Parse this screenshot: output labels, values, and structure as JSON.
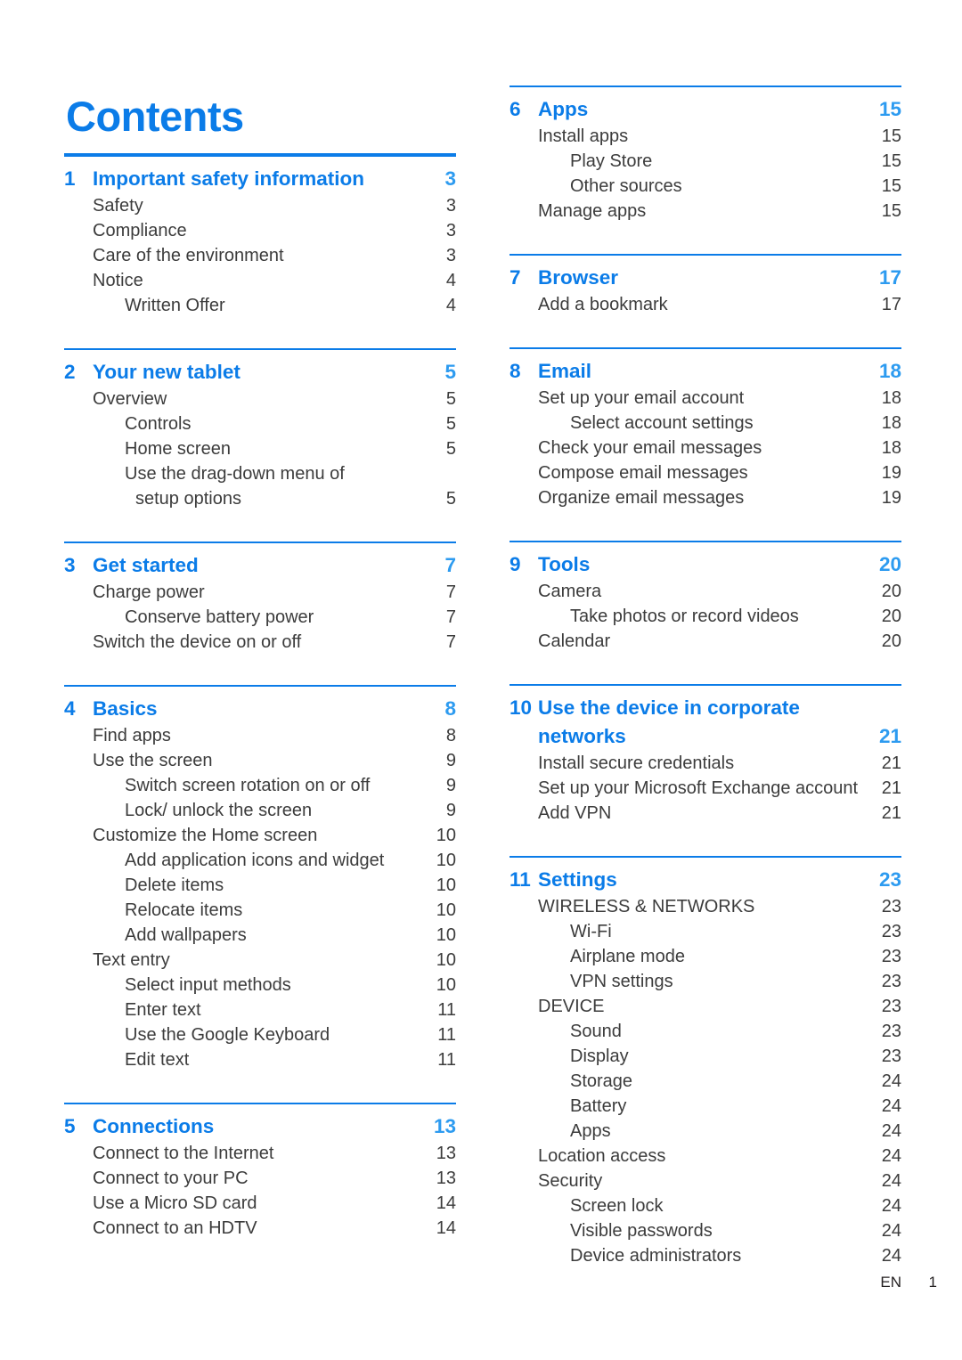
{
  "document": {
    "title": "Contents",
    "accent_color": "#0b7ce8",
    "text_color": "#3c3c3c"
  },
  "footer": {
    "language": "EN",
    "page_number": "1"
  },
  "columns": [
    {
      "name": "left",
      "chapters": [
        {
          "number": "1",
          "title": "Important safety information",
          "page": "3",
          "rule": "thick",
          "entries": [
            {
              "level": 1,
              "label": "Safety",
              "page": "3"
            },
            {
              "level": 1,
              "label": "Compliance",
              "page": "3"
            },
            {
              "level": 1,
              "label": "Care of the environment",
              "page": "3"
            },
            {
              "level": 1,
              "label": "Notice",
              "page": "4"
            },
            {
              "level": 2,
              "label": "Written Offer",
              "page": "4"
            }
          ]
        },
        {
          "number": "2",
          "title": "Your new tablet",
          "page": "5",
          "rule": "thin",
          "entries": [
            {
              "level": 1,
              "label": "Overview",
              "page": "5"
            },
            {
              "level": 2,
              "label": "Controls",
              "page": "5"
            },
            {
              "level": 2,
              "label": "Home screen",
              "page": "5"
            },
            {
              "level": 2,
              "label": "Use the drag-down menu of",
              "page": ""
            },
            {
              "level": 3,
              "label": "setup options",
              "page": "5"
            }
          ]
        },
        {
          "number": "3",
          "title": "Get started",
          "page": "7",
          "rule": "thin",
          "entries": [
            {
              "level": 1,
              "label": "Charge power",
              "page": "7"
            },
            {
              "level": 2,
              "label": "Conserve battery power",
              "page": "7"
            },
            {
              "level": 1,
              "label": "Switch the device on or off",
              "page": "7"
            }
          ]
        },
        {
          "number": "4",
          "title": "Basics",
          "page": "8",
          "rule": "thin",
          "entries": [
            {
              "level": 1,
              "label": "Find apps",
              "page": "8"
            },
            {
              "level": 1,
              "label": "Use the screen",
              "page": "9"
            },
            {
              "level": 2,
              "label": "Switch screen rotation on or off",
              "page": "9"
            },
            {
              "level": 2,
              "label": "Lock/ unlock the screen",
              "page": "9"
            },
            {
              "level": 1,
              "label": "Customize the Home screen",
              "page": "10"
            },
            {
              "level": 2,
              "label": "Add application icons and widget",
              "page": "10"
            },
            {
              "level": 2,
              "label": "Delete items",
              "page": "10"
            },
            {
              "level": 2,
              "label": "Relocate items",
              "page": "10"
            },
            {
              "level": 2,
              "label": "Add wallpapers",
              "page": "10"
            },
            {
              "level": 1,
              "label": "Text entry",
              "page": "10"
            },
            {
              "level": 2,
              "label": "Select input methods",
              "page": "10"
            },
            {
              "level": 2,
              "label": "Enter text",
              "page": "11"
            },
            {
              "level": 2,
              "label": "Use the Google Keyboard",
              "page": "11"
            },
            {
              "level": 2,
              "label": "Edit text",
              "page": "11"
            }
          ]
        },
        {
          "number": "5",
          "title": "Connections",
          "page": "13",
          "rule": "thin",
          "entries": [
            {
              "level": 1,
              "label": "Connect to the Internet",
              "page": "13"
            },
            {
              "level": 1,
              "label": "Connect to your PC",
              "page": "13"
            },
            {
              "level": 1,
              "label": "Use a Micro SD card",
              "page": "14"
            },
            {
              "level": 1,
              "label": "Connect to an HDTV",
              "page": "14"
            }
          ]
        }
      ]
    },
    {
      "name": "right",
      "chapters": [
        {
          "number": "6",
          "title": "Apps",
          "page": "15",
          "rule": "thin",
          "entries": [
            {
              "level": 1,
              "label": "Install apps",
              "page": "15"
            },
            {
              "level": 2,
              "label": "Play Store",
              "page": "15"
            },
            {
              "level": 2,
              "label": "Other sources",
              "page": "15"
            },
            {
              "level": 1,
              "label": "Manage apps",
              "page": "15"
            }
          ]
        },
        {
          "number": "7",
          "title": "Browser",
          "page": "17",
          "rule": "thin",
          "entries": [
            {
              "level": 1,
              "label": "Add a bookmark",
              "page": "17"
            }
          ]
        },
        {
          "number": "8",
          "title": "Email",
          "page": "18",
          "rule": "thin",
          "entries": [
            {
              "level": 1,
              "label": "Set up your email account",
              "page": "18"
            },
            {
              "level": 2,
              "label": "Select account settings",
              "page": "18"
            },
            {
              "level": 1,
              "label": "Check your email messages",
              "page": "18"
            },
            {
              "level": 1,
              "label": "Compose email messages",
              "page": "19"
            },
            {
              "level": 1,
              "label": "Organize email messages",
              "page": "19"
            }
          ]
        },
        {
          "number": "9",
          "title": "Tools",
          "page": "20",
          "rule": "thin",
          "entries": [
            {
              "level": 1,
              "label": "Camera",
              "page": "20"
            },
            {
              "level": 2,
              "label": "Take photos or record videos",
              "page": "20"
            },
            {
              "level": 1,
              "label": "Calendar",
              "page": "20"
            }
          ]
        },
        {
          "number": "10",
          "title": "Use the device in corporate",
          "title_cont": "networks",
          "page": "21",
          "rule": "thin",
          "entries": [
            {
              "level": 1,
              "label": "Install secure credentials",
              "page": "21"
            },
            {
              "level": 1,
              "label": "Set up your Microsoft Exchange account",
              "page": "21",
              "wide": true
            },
            {
              "level": 1,
              "label": "Add VPN",
              "page": "21"
            }
          ]
        },
        {
          "number": "11",
          "title": "Settings",
          "page": "23",
          "rule": "thin",
          "entries": [
            {
              "level": 1,
              "label": "WIRELESS & NETWORKS",
              "page": "23"
            },
            {
              "level": 2,
              "label": "Wi-Fi",
              "page": "23"
            },
            {
              "level": 2,
              "label": "Airplane mode",
              "page": "23"
            },
            {
              "level": 2,
              "label": "VPN settings",
              "page": "23"
            },
            {
              "level": 1,
              "label": "DEVICE",
              "page": "23"
            },
            {
              "level": 2,
              "label": "Sound",
              "page": "23"
            },
            {
              "level": 2,
              "label": "Display",
              "page": "23"
            },
            {
              "level": 2,
              "label": "Storage",
              "page": "24"
            },
            {
              "level": 2,
              "label": "Battery",
              "page": "24"
            },
            {
              "level": 2,
              "label": "Apps",
              "page": "24"
            },
            {
              "level": 1,
              "label": "Location access",
              "page": "24"
            },
            {
              "level": 1,
              "label": "Security",
              "page": "24"
            },
            {
              "level": 2,
              "label": "Screen lock",
              "page": "24"
            },
            {
              "level": 2,
              "label": "Visible passwords",
              "page": "24"
            },
            {
              "level": 2,
              "label": "Device administrators",
              "page": "24"
            }
          ]
        }
      ]
    }
  ]
}
